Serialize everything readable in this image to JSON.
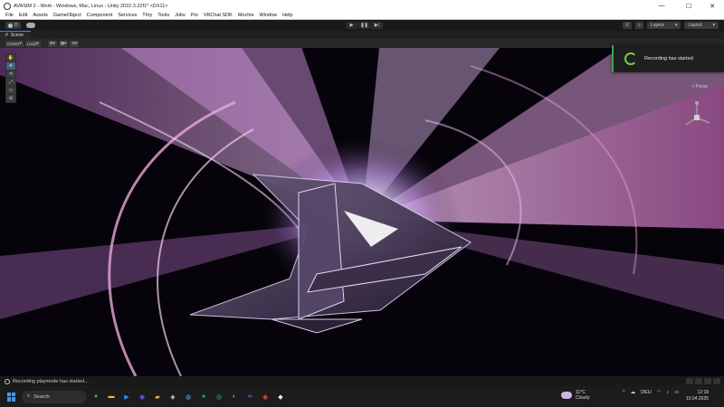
{
  "window": {
    "title": "AVASIM 2 - Work - Windows, Mac, Linux - Unity 2022.3.22f1* <DX11>",
    "minimize": "—",
    "maximize": "☐",
    "close": "✕"
  },
  "menu": [
    "File",
    "Edit",
    "Assets",
    "GameObject",
    "Component",
    "Services",
    "Thry",
    "Tools",
    "Jobs",
    "Poi",
    "VRChat SDK",
    "Mochie",
    "Window",
    "Help"
  ],
  "toolbar": {
    "account_label": "D",
    "cloud_icon": "cloud-icon",
    "play_icon": "▶",
    "pause_icon": "❚❚",
    "step_icon": "▶|",
    "history_icon": "↺",
    "search_icon": "⌕",
    "layers_label": "Layers",
    "layout_label": "Layout"
  },
  "scene_tab": {
    "label": "Scene",
    "pivot_label": "Center",
    "space_label": "Local"
  },
  "tools": [
    "✋",
    "✥",
    "⟲",
    "⤢",
    "▭",
    "⚙"
  ],
  "gizmo": {
    "projection_label": "< Persp"
  },
  "toast": {
    "message": "Recording has started"
  },
  "status": {
    "message": "Recording playmode has started..."
  },
  "taskbar": {
    "search_placeholder": "Search",
    "weather_temp": "11°C",
    "weather_desc": "Cloudy",
    "language": "DEU",
    "time": "12:18",
    "date": "10.04.2025",
    "apps": [
      {
        "name": "green-app-icon",
        "color": "#3cb371",
        "glyph": "●"
      },
      {
        "name": "file-explorer-icon",
        "color": "#f0c040",
        "glyph": "▬"
      },
      {
        "name": "zoom-icon",
        "color": "#2d8cff",
        "glyph": "▶"
      },
      {
        "name": "chat-icon",
        "color": "#5865f2",
        "glyph": "◉"
      },
      {
        "name": "folder-icon",
        "color": "#e8b84a",
        "glyph": "▰"
      },
      {
        "name": "unity-icon",
        "color": "#dddddd",
        "glyph": "◈"
      },
      {
        "name": "steam-icon",
        "color": "#6fa8dc",
        "glyph": "◍"
      },
      {
        "name": "spotify-icon",
        "color": "#1db954",
        "glyph": "●"
      },
      {
        "name": "whatsapp-icon",
        "color": "#25d366",
        "glyph": "◎"
      },
      {
        "name": "firefox-icon",
        "color": "#ff7139",
        "glyph": "◐"
      },
      {
        "name": "meta-icon",
        "color": "#4f8ff7",
        "glyph": "∞"
      },
      {
        "name": "chrome-icon",
        "color": "#e8453c",
        "glyph": "◉"
      },
      {
        "name": "vrchat-icon",
        "color": "#eeeeee",
        "glyph": "◆"
      }
    ]
  }
}
